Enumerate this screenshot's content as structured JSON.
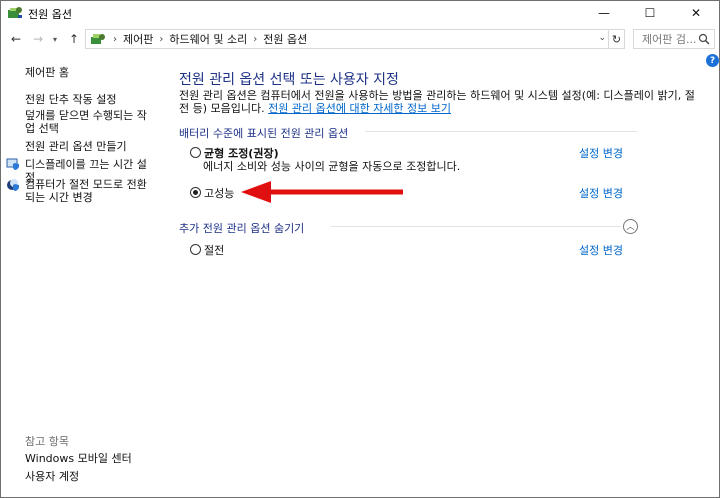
{
  "window": {
    "title": "전원 옵션",
    "buttons": {
      "minimize": "—",
      "maximize": "☐",
      "close": "✕"
    }
  },
  "address": {
    "breadcrumbs": [
      "제어판",
      "하드웨어 및 소리",
      "전원 옵션"
    ],
    "search_placeholder": "제어판 검..."
  },
  "help": {
    "label": "?"
  },
  "sidebar": {
    "home": "제어판 홈",
    "links": [
      "전원 단추 작동 설정",
      "덮개를 닫으면 수행되는 작업 선택",
      "전원 관리 옵션 만들기",
      "디스플레이를 끄는 시간 설정",
      "컴퓨터가 절전 모드로 전환되는 시간 변경"
    ],
    "see_also_header": "참고 항목",
    "see_also": [
      "Windows 모바일 센터",
      "사용자 계정"
    ]
  },
  "main": {
    "title": "전원 관리 옵션 선택 또는 사용자 지정",
    "description": "전원 관리 옵션은 컴퓨터에서 전원을 사용하는 방법을 관리하는 하드웨어 및 시스템 설정(예: 디스플레이 밝기, 절전 등) 모음입니다. ",
    "description_link": "전원 관리 옵션에 대한 자세한 정보 보기",
    "battery_section": "배터리 수준에 표시된 전원 관리 옵션",
    "plans": [
      {
        "label": "균형 조정(권장)",
        "description": "에너지 소비와 성능 사이의 균형을 자동으로 조정합니다.",
        "selected": false
      },
      {
        "label": "고성능",
        "selected": true
      }
    ],
    "hidden_section": "추가 전원 관리 옵션 숨기기",
    "hidden_plans": [
      {
        "label": "절전",
        "selected": false
      }
    ],
    "change_link": "설정 변경"
  },
  "colors": {
    "heading": "#1e3287",
    "link": "#0066cc",
    "arrow": "#e01010"
  }
}
